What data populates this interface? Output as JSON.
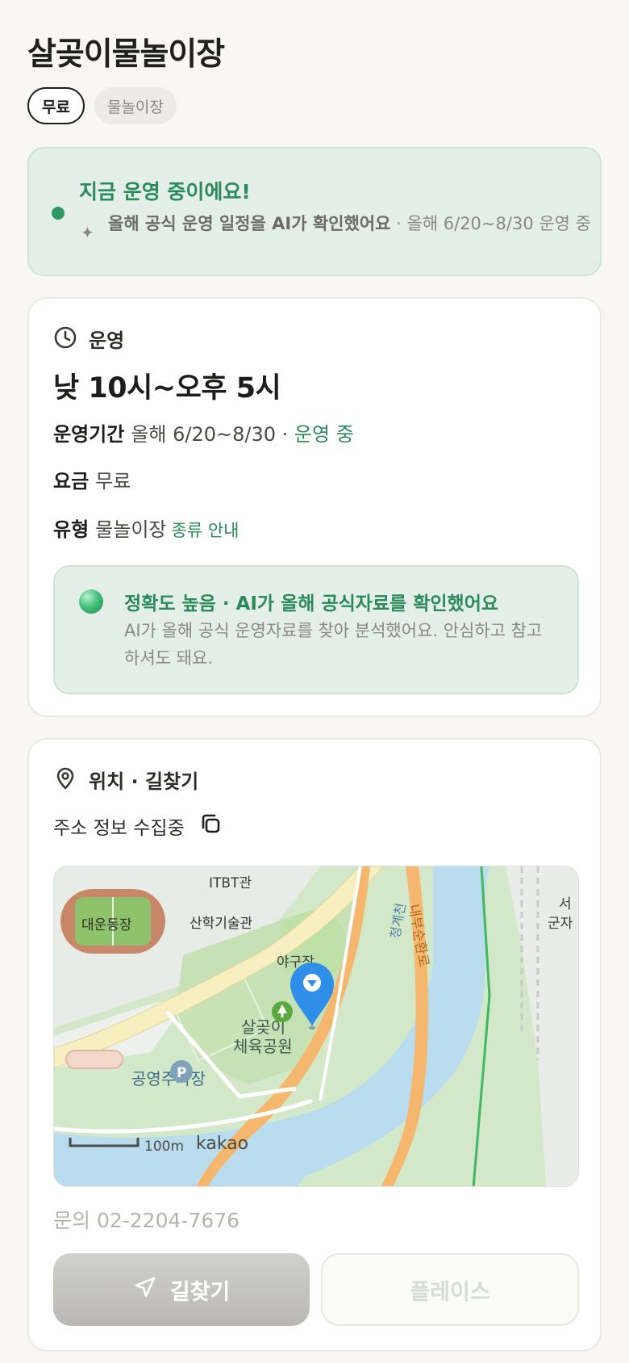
{
  "place": {
    "title": "살곶이물놀이장",
    "chips": [
      "무료",
      "물놀이장"
    ]
  },
  "status_banner": {
    "headline": "지금 운영 중이에요!",
    "sparkle_icon": "sparkle-icon",
    "sub_bold": "올해 공식 운영 일정을 AI가 확인했어요",
    "sub_rest": " · 올해 6/20~8/30 운영 중"
  },
  "operation": {
    "section_label": "운영",
    "hours": "낮 10시~오후 5시",
    "period_key": "운영기간",
    "period_value": "올해 6/20~8/30 ·",
    "period_status": "운영 중",
    "fee_key": "요금",
    "fee_value": "무료",
    "type_key": "유형",
    "type_value": "물놀이장",
    "type_link": "종류 안내",
    "accuracy": {
      "title": "정확도 높음 · AI가 올해 공식자료를 확인했어요",
      "desc": "AI가 올해 공식 운영자료를 찾아 분석했어요. 안심하고 참고하셔도 돼요."
    }
  },
  "location": {
    "section_label": "위치 · 길찾기",
    "address": "주소 정보 수집중",
    "map": {
      "labels": [
        "ITBT관",
        "대운동장",
        "산학기술관",
        "야구장",
        "살곶이",
        "체육공원",
        "공영주차장",
        "청계천",
        "내부순환로",
        "서",
        "군자"
      ],
      "scale": "100m",
      "brand": "kakao",
      "parking_symbol": "P"
    },
    "contact": "문의 02-2204-7676",
    "directions_button": "길찾기",
    "place_button": "플레이스"
  },
  "colors": {
    "accent_green": "#2a8a5a",
    "banner_bg": "#e5efe9",
    "pin_blue": "#2f8fe8"
  }
}
